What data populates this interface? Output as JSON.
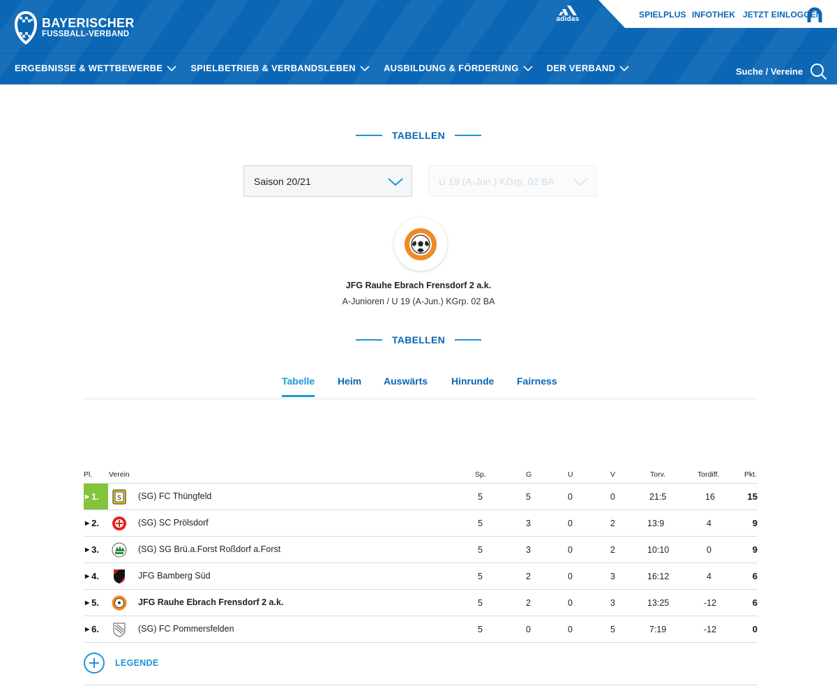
{
  "header": {
    "logo_line1": "BAYERISCHER",
    "logo_line2": "FUSSBALL-VERBAND",
    "logo_badge": "BFV",
    "sponsor": "adidas",
    "top_links": [
      "SPIELPLUS",
      "INFOTHEK",
      "JETZT EINLOGGEN"
    ],
    "nav": [
      {
        "label": "ERGEBNISSE & WETTBEWERBE"
      },
      {
        "label": "SPIELBETRIEB & VERBANDSLEBEN"
      },
      {
        "label": "AUSBILDUNG & FÖRDERUNG"
      },
      {
        "label": "DER VERBAND"
      }
    ],
    "search_label": "Suche / Vereine"
  },
  "colors": {
    "brand": "#0b66b5",
    "accent": "#1c95d6",
    "promotion": "#82c53a"
  },
  "section_title": "TABELLEN",
  "section_title_2": "TABELLEN",
  "filters": {
    "season": "Saison 20/21",
    "league": "U 19 (A-Jun.) KGrp. 02 BA"
  },
  "team": {
    "name": "JFG Rauhe Ebrach Frensdorf 2 a.k.",
    "league": "A-Junioren / U 19 (A-Jun.) KGrp. 02 BA"
  },
  "tabs": [
    "Tabelle",
    "Heim",
    "Auswärts",
    "Hinrunde",
    "Fairness"
  ],
  "active_tab": "Tabelle",
  "table": {
    "headers": {
      "pl": "Pl.",
      "verein": "Verein",
      "sp": "Sp.",
      "g": "G",
      "u": "U",
      "v": "V",
      "torv": "Torv.",
      "tordiff": "Tordiff.",
      "pkt": "Pkt."
    },
    "rows": [
      {
        "pl": "1.",
        "club": "(SG) FC Thüngfeld",
        "sp": "5",
        "g": "5",
        "u": "0",
        "v": "0",
        "torv": "21:5",
        "tordiff": "16",
        "pkt": "15",
        "logo": "thuengfeld-crest-icon"
      },
      {
        "pl": "2.",
        "club": "(SG) SC Prölsdorf",
        "sp": "5",
        "g": "3",
        "u": "0",
        "v": "2",
        "torv": "13:9",
        "tordiff": "4",
        "pkt": "9",
        "logo": "proelsdorf-crest-icon"
      },
      {
        "pl": "3.",
        "club": "(SG) SG Brü.a.Forst Roßdorf a.Forst",
        "sp": "5",
        "g": "3",
        "u": "0",
        "v": "2",
        "torv": "10:10",
        "tordiff": "0",
        "pkt": "9",
        "logo": "forst-crest-icon"
      },
      {
        "pl": "4.",
        "club": "JFG Bamberg Süd",
        "sp": "5",
        "g": "2",
        "u": "0",
        "v": "3",
        "torv": "16:12",
        "tordiff": "4",
        "pkt": "6",
        "logo": "bamberg-sued-crest-icon"
      },
      {
        "pl": "5.",
        "club": "JFG Rauhe Ebrach Frensdorf 2 a.k.",
        "sp": "5",
        "g": "2",
        "u": "0",
        "v": "3",
        "torv": "13:25",
        "tordiff": "-12",
        "pkt": "6",
        "logo": "rauhe-ebrach-crest-icon"
      },
      {
        "pl": "6.",
        "club": "(SG) FC Pommersfelden",
        "sp": "5",
        "g": "0",
        "u": "0",
        "v": "5",
        "torv": "7:19",
        "tordiff": "-12",
        "pkt": "0",
        "logo": "pommersfelden-crest-icon"
      }
    ]
  },
  "legend_label": "LEGENDE"
}
